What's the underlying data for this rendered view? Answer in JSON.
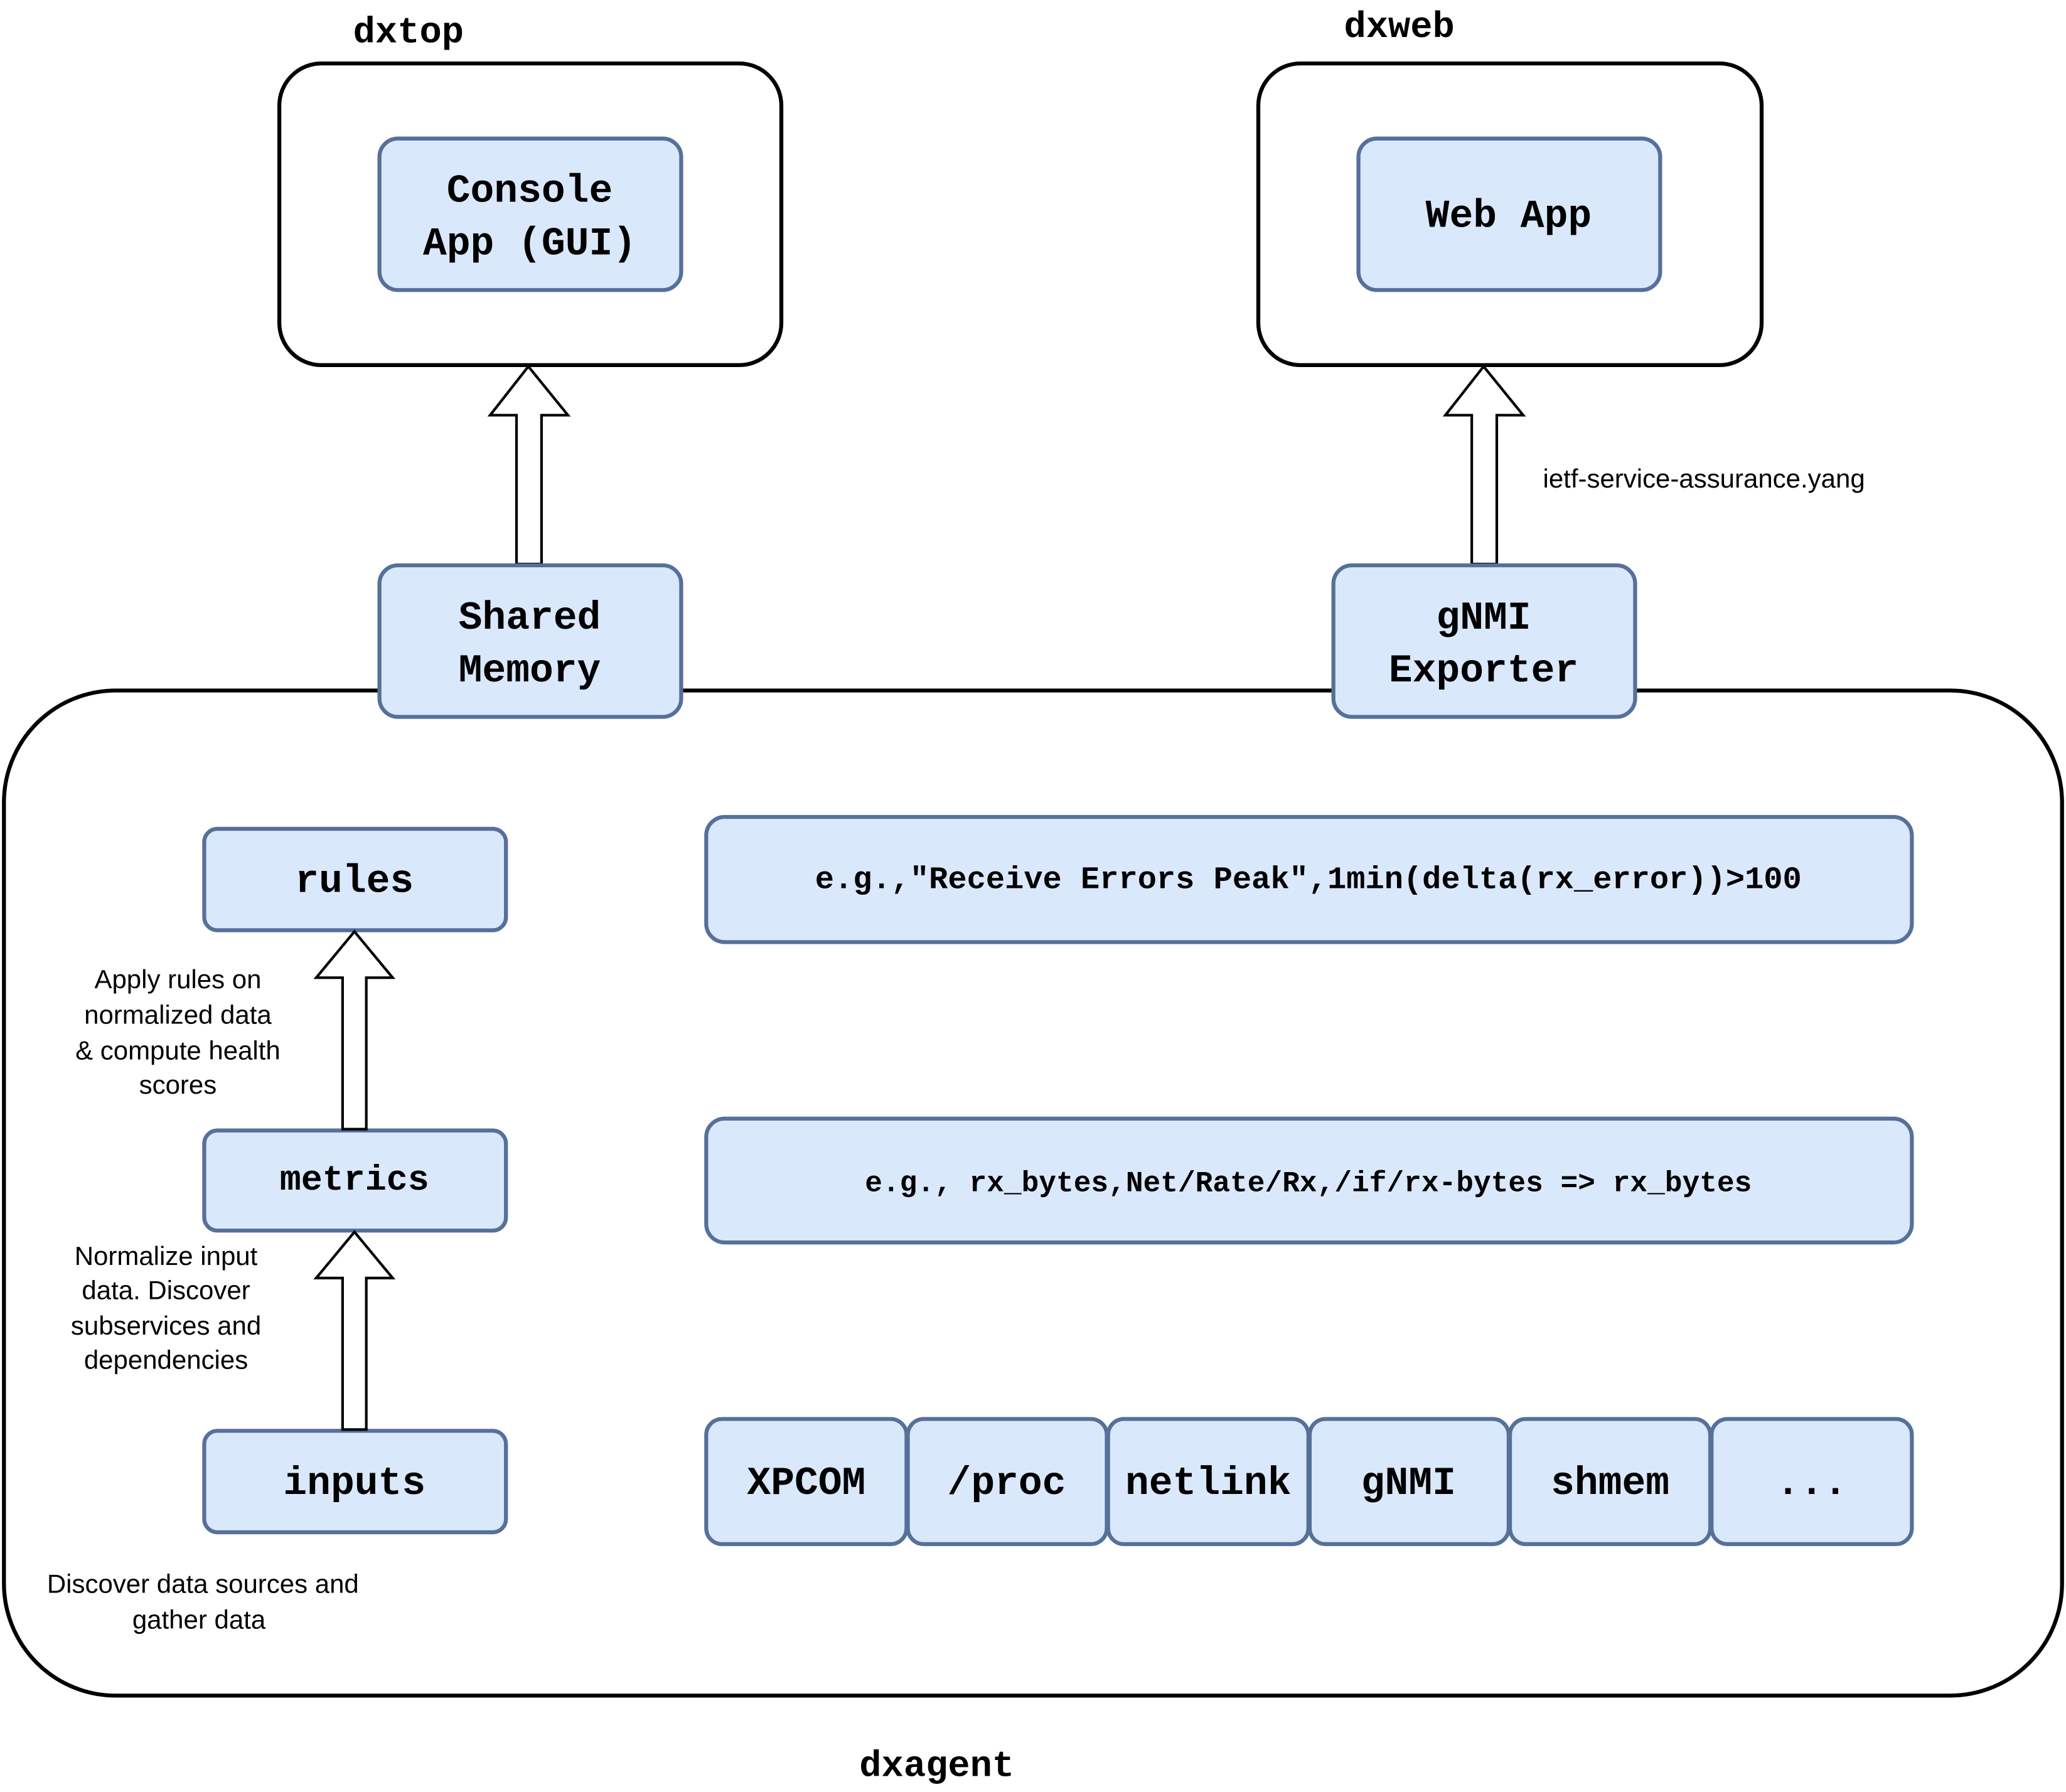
{
  "colors": {
    "box_fill": "#dae8fc",
    "box_stroke": "#56709a",
    "container_stroke": "#000000"
  },
  "dxtop": {
    "label": "dxtop",
    "console_app": [
      "Console",
      "App (GUI)"
    ]
  },
  "dxweb": {
    "label": "dxweb",
    "web_app": "Web App",
    "yang_label": "ietf-service-assurance.yang"
  },
  "interfaces": {
    "shared_memory": [
      "Shared",
      "Memory"
    ],
    "gnmi_exporter": [
      "gNMI",
      "Exporter"
    ]
  },
  "dxagent": {
    "label": "dxagent",
    "rules": "rules",
    "metrics": "metrics",
    "inputs": "inputs",
    "rules_note": [
      "Apply rules on",
      "normalized data",
      "& compute health",
      "scores"
    ],
    "metrics_note": [
      "Normalize input",
      "data. Discover",
      "subservices and",
      "dependencies"
    ],
    "inputs_note": [
      "Discover data sources and",
      "gather data"
    ],
    "rules_example": "e.g.,\"Receive Errors Peak\",1min(delta(rx_error))>100",
    "metrics_example": "e.g., rx_bytes,Net/Rate/Rx,/if/rx-bytes => rx_bytes",
    "sources": [
      "XPCOM",
      "/proc",
      "netlink",
      "gNMI",
      "shmem",
      "..."
    ]
  }
}
